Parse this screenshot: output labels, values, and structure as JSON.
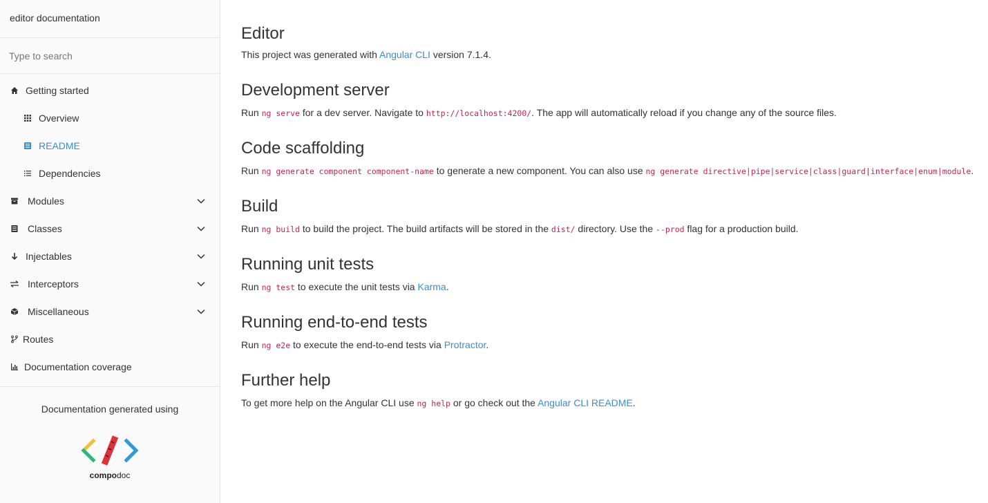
{
  "sidebar": {
    "title": "editor documentation",
    "search_placeholder": "Type to search",
    "items": [
      {
        "label": "Getting started",
        "icon": "home-icon",
        "level": 0
      },
      {
        "label": "Overview",
        "icon": "grid-icon",
        "level": 1
      },
      {
        "label": "README",
        "icon": "book-icon",
        "level": 1,
        "active": true
      },
      {
        "label": "Dependencies",
        "icon": "list-icon",
        "level": 1
      },
      {
        "label": "Modules",
        "icon": "archive-icon",
        "level": 0,
        "expandable": true
      },
      {
        "label": "Classes",
        "icon": "file-icon",
        "level": 0,
        "expandable": true
      },
      {
        "label": "Injectables",
        "icon": "arrow-down-icon",
        "level": 0,
        "expandable": true
      },
      {
        "label": "Interceptors",
        "icon": "exchange-icon",
        "level": 0,
        "expandable": true
      },
      {
        "label": "Miscellaneous",
        "icon": "cube-icon",
        "level": 0,
        "expandable": true
      },
      {
        "label": "Routes",
        "icon": "code-fork-icon",
        "level": 0
      },
      {
        "label": "Documentation coverage",
        "icon": "bar-chart-icon",
        "level": 0
      }
    ],
    "footer_text": "Documentation generated using",
    "logo_text_bold": "compo",
    "logo_text_normal": "doc"
  },
  "content": {
    "title": "Editor",
    "intro": {
      "before": "This project was generated with ",
      "link": "Angular CLI",
      "after": " version 7.1.4."
    },
    "sections": {
      "dev_server": {
        "heading": "Development server",
        "t1": "Run ",
        "c1": "ng serve",
        "t2": " for a dev server. Navigate to ",
        "c2": "http://localhost:4200/",
        "t3": ". The app will automatically reload if you change any of the source files."
      },
      "scaffolding": {
        "heading": "Code scaffolding",
        "t1": "Run ",
        "c1": "ng generate component component-name",
        "t2": " to generate a new component. You can also use ",
        "c2": "ng generate directive|pipe|service|class|guard|interface|enum|module",
        "t3": "."
      },
      "build": {
        "heading": "Build",
        "t1": "Run ",
        "c1": "ng build",
        "t2": " to build the project. The build artifacts will be stored in the ",
        "c2": "dist/",
        "t3": " directory. Use the ",
        "c3": "--prod",
        "t4": " flag for a production build."
      },
      "unit_tests": {
        "heading": "Running unit tests",
        "t1": "Run ",
        "c1": "ng test",
        "t2": " to execute the unit tests via ",
        "link": "Karma",
        "t3": "."
      },
      "e2e_tests": {
        "heading": "Running end-to-end tests",
        "t1": "Run ",
        "c1": "ng e2e",
        "t2": " to execute the end-to-end tests via ",
        "link": "Protractor",
        "t3": "."
      },
      "help": {
        "heading": "Further help",
        "t1": "To get more help on the Angular CLI use ",
        "c1": "ng help",
        "t2": " or go check out the ",
        "link": "Angular CLI README",
        "t3": "."
      }
    }
  },
  "colors": {
    "link": "#3c8dce",
    "code": "#c7254e",
    "text": "#333333"
  }
}
